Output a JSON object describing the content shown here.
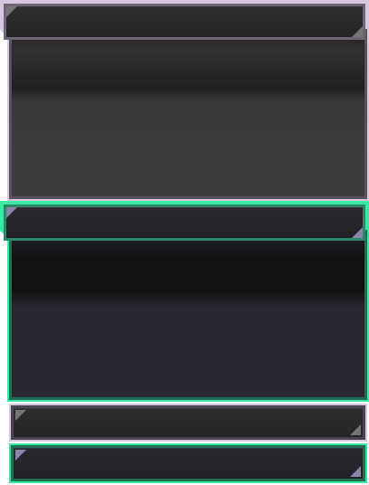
{
  "panels": [
    {
      "id": "panel-large-grey",
      "theme": "grey-lavender",
      "border_color": "#d7c8dc"
    },
    {
      "id": "panel-large-green",
      "theme": "green",
      "border_color": "#3ce8a4"
    }
  ],
  "bars": [
    {
      "id": "bar-small-grey",
      "theme": "grey-lavender",
      "border_color": "#d7c8dc"
    },
    {
      "id": "bar-small-green",
      "theme": "green",
      "border_color": "#3ce8a4"
    }
  ],
  "icons": {
    "corner": "corner-triangle-icon"
  }
}
